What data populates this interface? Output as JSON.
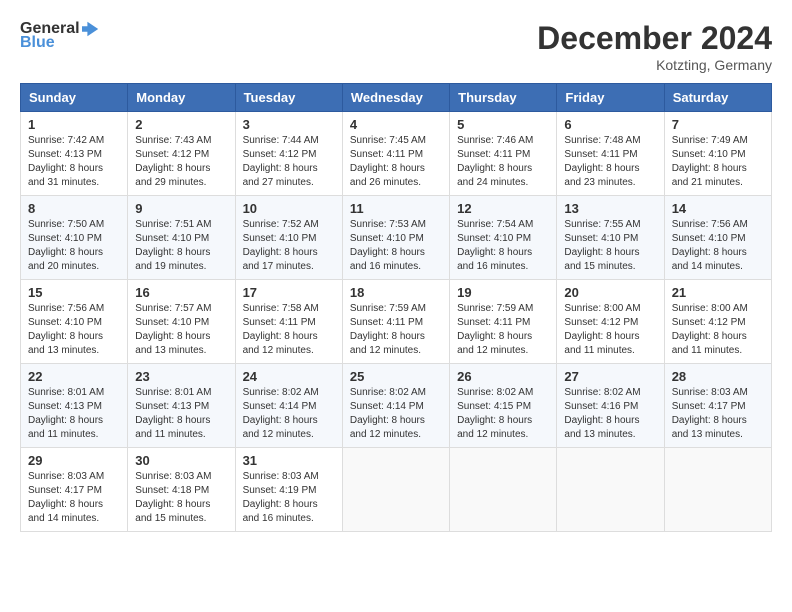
{
  "header": {
    "logo_general": "General",
    "logo_blue": "Blue",
    "month_title": "December 2024",
    "location": "Kotzting, Germany"
  },
  "days_of_week": [
    "Sunday",
    "Monday",
    "Tuesday",
    "Wednesday",
    "Thursday",
    "Friday",
    "Saturday"
  ],
  "weeks": [
    [
      {
        "day": "1",
        "sunrise": "7:42 AM",
        "sunset": "4:13 PM",
        "daylight": "8 hours and 31 minutes."
      },
      {
        "day": "2",
        "sunrise": "7:43 AM",
        "sunset": "4:12 PM",
        "daylight": "8 hours and 29 minutes."
      },
      {
        "day": "3",
        "sunrise": "7:44 AM",
        "sunset": "4:12 PM",
        "daylight": "8 hours and 27 minutes."
      },
      {
        "day": "4",
        "sunrise": "7:45 AM",
        "sunset": "4:11 PM",
        "daylight": "8 hours and 26 minutes."
      },
      {
        "day": "5",
        "sunrise": "7:46 AM",
        "sunset": "4:11 PM",
        "daylight": "8 hours and 24 minutes."
      },
      {
        "day": "6",
        "sunrise": "7:48 AM",
        "sunset": "4:11 PM",
        "daylight": "8 hours and 23 minutes."
      },
      {
        "day": "7",
        "sunrise": "7:49 AM",
        "sunset": "4:10 PM",
        "daylight": "8 hours and 21 minutes."
      }
    ],
    [
      {
        "day": "8",
        "sunrise": "7:50 AM",
        "sunset": "4:10 PM",
        "daylight": "8 hours and 20 minutes."
      },
      {
        "day": "9",
        "sunrise": "7:51 AM",
        "sunset": "4:10 PM",
        "daylight": "8 hours and 19 minutes."
      },
      {
        "day": "10",
        "sunrise": "7:52 AM",
        "sunset": "4:10 PM",
        "daylight": "8 hours and 17 minutes."
      },
      {
        "day": "11",
        "sunrise": "7:53 AM",
        "sunset": "4:10 PM",
        "daylight": "8 hours and 16 minutes."
      },
      {
        "day": "12",
        "sunrise": "7:54 AM",
        "sunset": "4:10 PM",
        "daylight": "8 hours and 16 minutes."
      },
      {
        "day": "13",
        "sunrise": "7:55 AM",
        "sunset": "4:10 PM",
        "daylight": "8 hours and 15 minutes."
      },
      {
        "day": "14",
        "sunrise": "7:56 AM",
        "sunset": "4:10 PM",
        "daylight": "8 hours and 14 minutes."
      }
    ],
    [
      {
        "day": "15",
        "sunrise": "7:56 AM",
        "sunset": "4:10 PM",
        "daylight": "8 hours and 13 minutes."
      },
      {
        "day": "16",
        "sunrise": "7:57 AM",
        "sunset": "4:10 PM",
        "daylight": "8 hours and 13 minutes."
      },
      {
        "day": "17",
        "sunrise": "7:58 AM",
        "sunset": "4:11 PM",
        "daylight": "8 hours and 12 minutes."
      },
      {
        "day": "18",
        "sunrise": "7:59 AM",
        "sunset": "4:11 PM",
        "daylight": "8 hours and 12 minutes."
      },
      {
        "day": "19",
        "sunrise": "7:59 AM",
        "sunset": "4:11 PM",
        "daylight": "8 hours and 12 minutes."
      },
      {
        "day": "20",
        "sunrise": "8:00 AM",
        "sunset": "4:12 PM",
        "daylight": "8 hours and 11 minutes."
      },
      {
        "day": "21",
        "sunrise": "8:00 AM",
        "sunset": "4:12 PM",
        "daylight": "8 hours and 11 minutes."
      }
    ],
    [
      {
        "day": "22",
        "sunrise": "8:01 AM",
        "sunset": "4:13 PM",
        "daylight": "8 hours and 11 minutes."
      },
      {
        "day": "23",
        "sunrise": "8:01 AM",
        "sunset": "4:13 PM",
        "daylight": "8 hours and 11 minutes."
      },
      {
        "day": "24",
        "sunrise": "8:02 AM",
        "sunset": "4:14 PM",
        "daylight": "8 hours and 12 minutes."
      },
      {
        "day": "25",
        "sunrise": "8:02 AM",
        "sunset": "4:14 PM",
        "daylight": "8 hours and 12 minutes."
      },
      {
        "day": "26",
        "sunrise": "8:02 AM",
        "sunset": "4:15 PM",
        "daylight": "8 hours and 12 minutes."
      },
      {
        "day": "27",
        "sunrise": "8:02 AM",
        "sunset": "4:16 PM",
        "daylight": "8 hours and 13 minutes."
      },
      {
        "day": "28",
        "sunrise": "8:03 AM",
        "sunset": "4:17 PM",
        "daylight": "8 hours and 13 minutes."
      }
    ],
    [
      {
        "day": "29",
        "sunrise": "8:03 AM",
        "sunset": "4:17 PM",
        "daylight": "8 hours and 14 minutes."
      },
      {
        "day": "30",
        "sunrise": "8:03 AM",
        "sunset": "4:18 PM",
        "daylight": "8 hours and 15 minutes."
      },
      {
        "day": "31",
        "sunrise": "8:03 AM",
        "sunset": "4:19 PM",
        "daylight": "8 hours and 16 minutes."
      },
      null,
      null,
      null,
      null
    ]
  ]
}
